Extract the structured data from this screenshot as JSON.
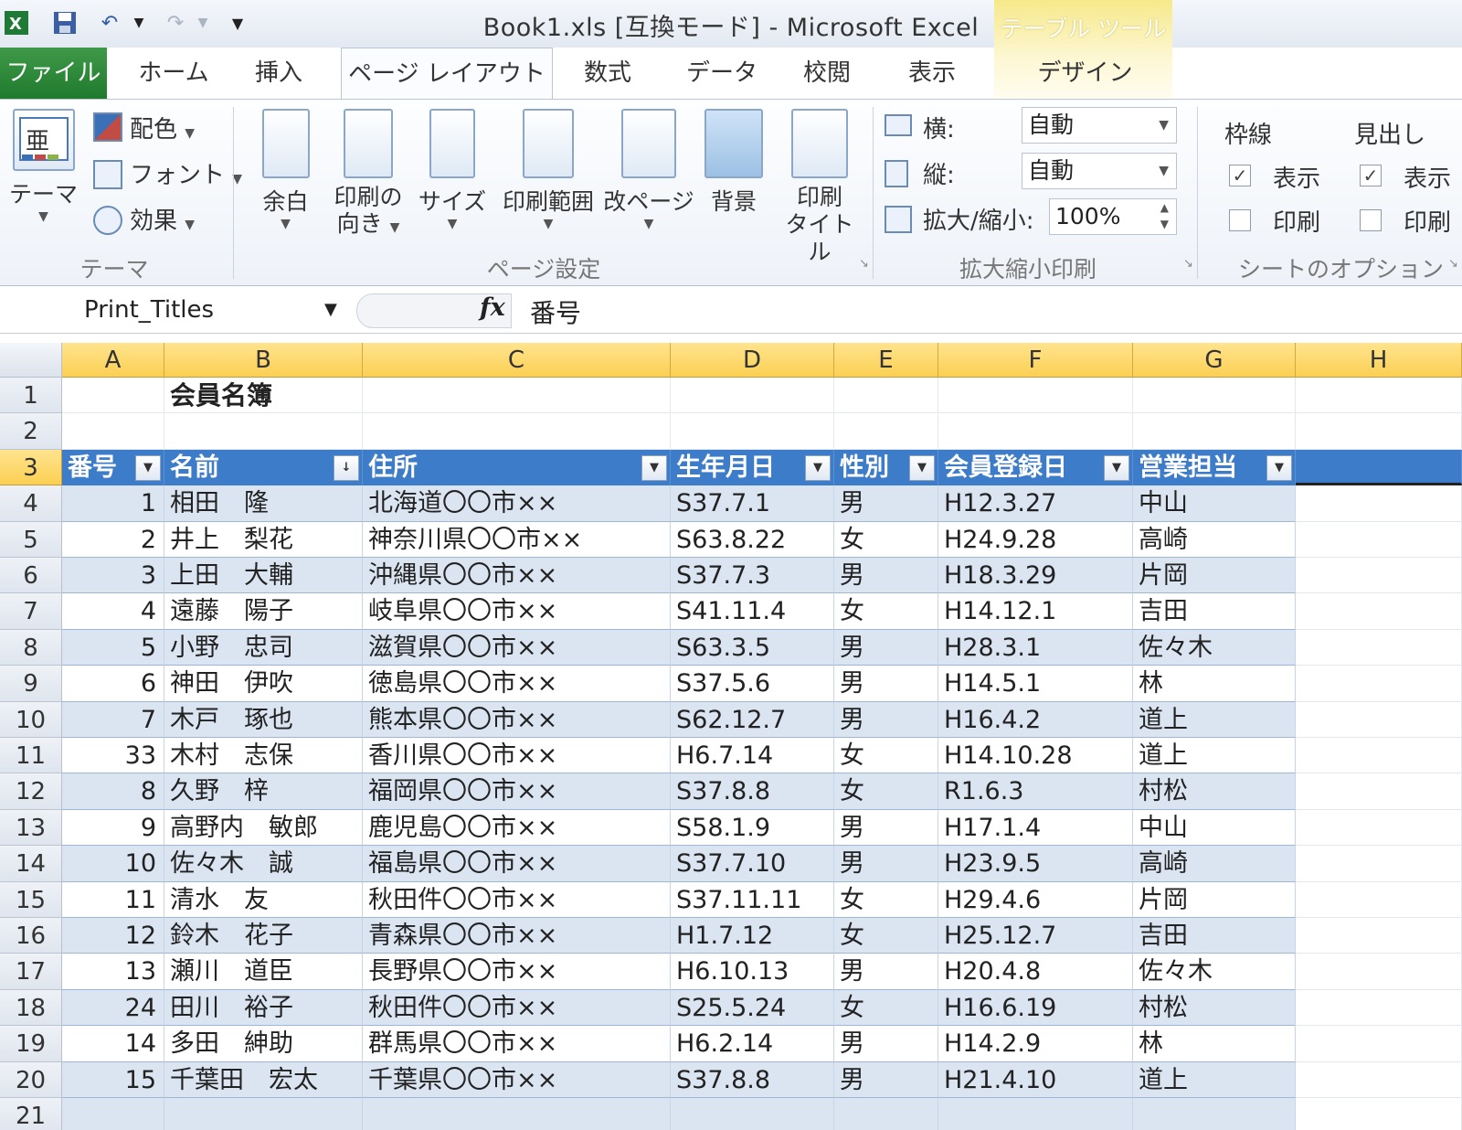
{
  "window": {
    "title": "Book1.xls  [互換モード]  -  Microsoft Excel",
    "table_tools": "テーブル ツール"
  },
  "quick_access": [
    "excel-logo-icon",
    "save-icon",
    "undo-icon",
    "redo-icon",
    "customize-icon"
  ],
  "tabs": [
    "ファイル",
    "ホーム",
    "挿入",
    "ページ レイアウト",
    "数式",
    "データ",
    "校閲",
    "表示",
    "デザイン"
  ],
  "ribbon": {
    "theme": {
      "themes": "テーマ",
      "colors": "配色",
      "fonts": "フォント",
      "effects": "効果",
      "group": "テーマ"
    },
    "page_setup": {
      "margins": "余白",
      "orientation_1": "印刷の",
      "orientation_2": "向き",
      "size": "サイズ",
      "print_area": "印刷範囲",
      "breaks": "改ページ",
      "background": "背景",
      "print_titles_1": "印刷",
      "print_titles_2": "タイトル",
      "group": "ページ設定"
    },
    "scale": {
      "width_label": "横:",
      "width_value": "自動",
      "height_label": "縦:",
      "height_value": "自動",
      "scale_label": "拡大/縮小:",
      "scale_value": "100%",
      "group": "拡大縮小印刷"
    },
    "sheet_options": {
      "gridlines": "枠線",
      "headings": "見出し",
      "view": "表示",
      "print": "印刷",
      "gridlines_view_checked": true,
      "gridlines_print_checked": false,
      "headings_view_checked": true,
      "headings_print_checked": false,
      "group": "シートのオプション"
    }
  },
  "formula_bar": {
    "name_box": "Print_Titles",
    "fx": "fx",
    "formula": "番号"
  },
  "sheet": {
    "columns": [
      "A",
      "B",
      "C",
      "D",
      "E",
      "F",
      "G",
      "H"
    ],
    "row_numbers": [
      "1",
      "2",
      "3",
      "4",
      "5",
      "6",
      "7",
      "8",
      "9",
      "10",
      "11",
      "12",
      "13",
      "14",
      "15",
      "16",
      "17",
      "18",
      "19",
      "20",
      "21"
    ],
    "title": "会員名簿",
    "headers": [
      "番号",
      "名前",
      "住所",
      "生年月日",
      "性別",
      "会員登録日",
      "営業担当"
    ],
    "rows": [
      [
        "1",
        "相田　隆",
        "北海道〇〇市××",
        "S37.7.1",
        "男",
        "H12.3.27",
        "中山"
      ],
      [
        "2",
        "井上　梨花",
        "神奈川県〇〇市××",
        "S63.8.22",
        "女",
        "H24.9.28",
        "高崎"
      ],
      [
        "3",
        "上田　大輔",
        "沖縄県〇〇市××",
        "S37.7.3",
        "男",
        "H18.3.29",
        "片岡"
      ],
      [
        "4",
        "遠藤　陽子",
        "岐阜県〇〇市××",
        "S41.11.4",
        "女",
        "H14.12.1",
        "吉田"
      ],
      [
        "5",
        "小野　忠司",
        "滋賀県〇〇市××",
        "S63.3.5",
        "男",
        "H28.3.1",
        "佐々木"
      ],
      [
        "6",
        "神田　伊吹",
        "徳島県〇〇市××",
        "S37.5.6",
        "男",
        "H14.5.1",
        "林"
      ],
      [
        "7",
        "木戸　琢也",
        "熊本県〇〇市××",
        "S62.12.7",
        "男",
        "H16.4.2",
        "道上"
      ],
      [
        "33",
        "木村　志保",
        "香川県〇〇市××",
        "H6.7.14",
        "女",
        "H14.10.28",
        "道上"
      ],
      [
        "8",
        "久野　梓",
        "福岡県〇〇市××",
        "S37.8.8",
        "女",
        "R1.6.3",
        "村松"
      ],
      [
        "9",
        "高野内　敏郎",
        "鹿児島〇〇市××",
        "S58.1.9",
        "男",
        "H17.1.4",
        "中山"
      ],
      [
        "10",
        "佐々木　誠",
        "福島県〇〇市××",
        "S37.7.10",
        "男",
        "H23.9.5",
        "高崎"
      ],
      [
        "11",
        "清水　友",
        "秋田件〇〇市××",
        "S37.11.11",
        "女",
        "H29.4.6",
        "片岡"
      ],
      [
        "12",
        "鈴木　花子",
        "青森県〇〇市××",
        "H1.7.12",
        "女",
        "H25.12.7",
        "吉田"
      ],
      [
        "13",
        "瀬川　道臣",
        "長野県〇〇市××",
        "H6.10.13",
        "男",
        "H20.4.8",
        "佐々木"
      ],
      [
        "24",
        "田川　裕子",
        "秋田件〇〇市××",
        "S25.5.24",
        "女",
        "H16.6.19",
        "村松"
      ],
      [
        "14",
        "多田　紳助",
        "群馬県〇〇市××",
        "H6.2.14",
        "男",
        "H14.2.9",
        "林"
      ],
      [
        "15",
        "千葉田　宏太",
        "千葉県〇〇市××",
        "S37.8.8",
        "男",
        "H21.4.10",
        "道上"
      ]
    ]
  }
}
